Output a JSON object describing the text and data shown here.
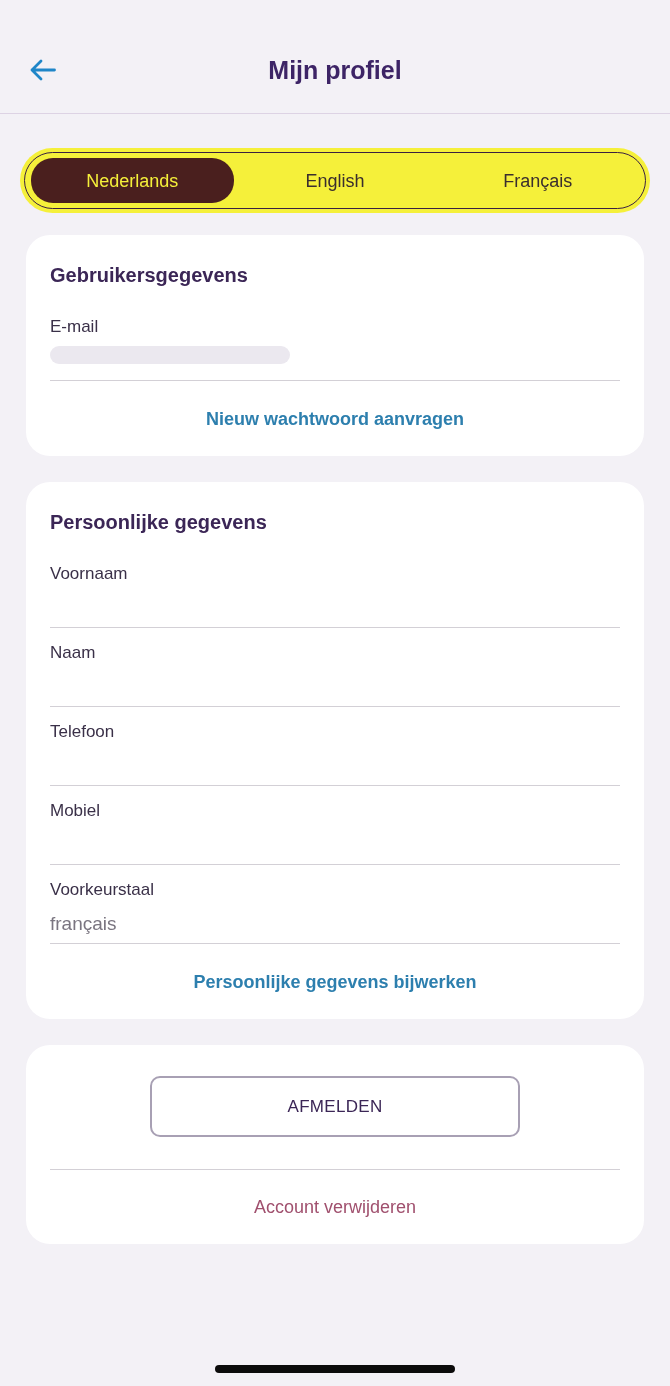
{
  "header": {
    "title": "Mijn profiel"
  },
  "language_tabs": [
    {
      "label": "Nederlands",
      "selected": true
    },
    {
      "label": "English",
      "selected": false
    },
    {
      "label": "Français",
      "selected": false
    }
  ],
  "account": {
    "title": "Gebruikersgegevens",
    "email": {
      "label": "E-mail",
      "redacted": true
    },
    "link": "Nieuw wachtwoord aanvragen"
  },
  "personal": {
    "title": "Persoonlijke gegevens",
    "fields": [
      {
        "label": "Voornaam"
      },
      {
        "label": "Naam"
      },
      {
        "label": "Telefoon"
      },
      {
        "label": "Mobiel"
      },
      {
        "label": "Voorkeurstaal",
        "value": "français"
      }
    ],
    "link": "Persoonlijke gegevens bijwerken"
  },
  "session": {
    "button": "AFMELDEN",
    "link": "Account verwijderen"
  }
}
